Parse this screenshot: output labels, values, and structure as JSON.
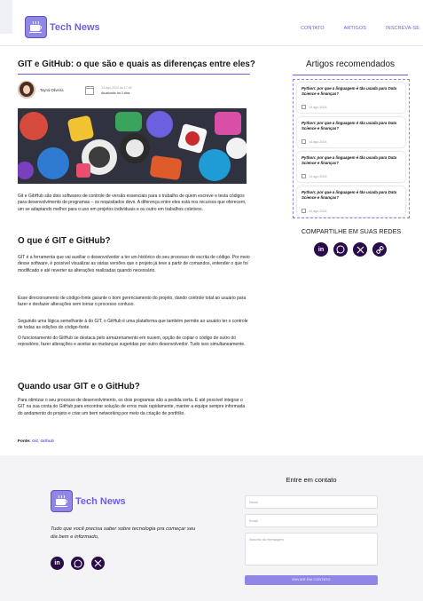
{
  "header": {
    "brand": "Tech News",
    "nav": [
      "CONTATO",
      "ARTIGOS",
      "INSCREVA-SE"
    ]
  },
  "article": {
    "title": "GIT e GitHub: o que são e quais as diferenças entre eles?",
    "author": "Tayná Oliveira",
    "date_published": "14.ago.2024 às 17:00",
    "date_updated": "Atualizado há 3 dias",
    "intro": "Git e GibHub são dois softwares de controle de versão essenciais para o trabalho de quem escreve e testa códigos para desenvolvimento de programas – os requisitados devs. A diferença entre eles está nos recursos que oferecem, um se adaptando melhor para o uso em projetos individuais e ou outro em trabalhos coletivos.",
    "section1_title": "O que é GIT e GitHub?",
    "section1_p1": "GIT é a ferramenta que vai auxiliar o desenvolvedor a ter um histórico do seu processo de escrita de código. Por meio desse software, é possível visualizar as várias versões que o projeto já teve a partir de comandos, entender o que foi modificado e até reverter as alterações realizadas quando necessário.",
    "section1_p2": "Esse direcionamento de código-fonte garante o bom gerenciamento do projeto, dando controle total ao usuário para fazer e desfazer alterações sem tornar o processo confuso.",
    "section1_p3": "Seguindo uma lógica semelhante à do GIT, o GitHub é uma plataforma que também permite ao usuário ter o controle de todas as edições do código-fonte.",
    "section1_p4": "O funcionamento do GitHub se destaca pelo armazenamento em nuvem, opção de copiar o código de outro do repositório, fazer alterações e aceitar as mudanças sugeridas por outro desenvolvedor. Tudo isso simultaneamente.",
    "section2_title": "Quando usar GIT e o GitHub?",
    "section2_p1": "Para otimizar o seu processo de desenvolvimento, os dois programas são a pedida certa. E até possível integrar o GIT na sua conta do GitHub para encontrar solução de erros mais rapidamente, manter a equipe sempre informada do andamento do projeto e criar um bem networking por meio da criação de portfólio.",
    "source_label": "Fonte:",
    "source_links": "Git, Github"
  },
  "sidebar": {
    "title": "Artigos recomendados",
    "cards": [
      {
        "title": "Python: por que a linguagem é tão usada para Data Science e finanças?",
        "date": "14.ago.2024"
      },
      {
        "title": "Python: por que a linguagem é tão usada para Data Science e finanças?",
        "date": "14.ago.2024"
      },
      {
        "title": "Python: por que a linguagem é tão usada para Data Science e finanças?",
        "date": "14.ago.2024"
      },
      {
        "title": "Python: por que a linguagem é tão usada para Data Science e finanças?",
        "date": "14.ago.2024"
      }
    ],
    "share_title": "COMPARTILHE EM SUAS REDES",
    "share_icons": [
      "linkedin-icon",
      "whatsapp-icon",
      "x-icon",
      "link-icon"
    ]
  },
  "footer": {
    "brand": "Tech News",
    "tagline": "Tudo que você precisa saber sobre tecnologia pra começar seu dia bem e informado,",
    "social_icons": [
      "linkedin-icon",
      "whatsapp-icon",
      "x-icon"
    ],
    "contact_title": "Entre em contato",
    "name_placeholder": "Nome",
    "email_placeholder": "Email",
    "message_placeholder": "Assunto da mensagem",
    "send_label": "ENVIAR EM CONTATO"
  },
  "colors": {
    "accent": "#6c5fe0",
    "accent_light": "#8f86e8",
    "social_bg": "#2a0b4a"
  }
}
